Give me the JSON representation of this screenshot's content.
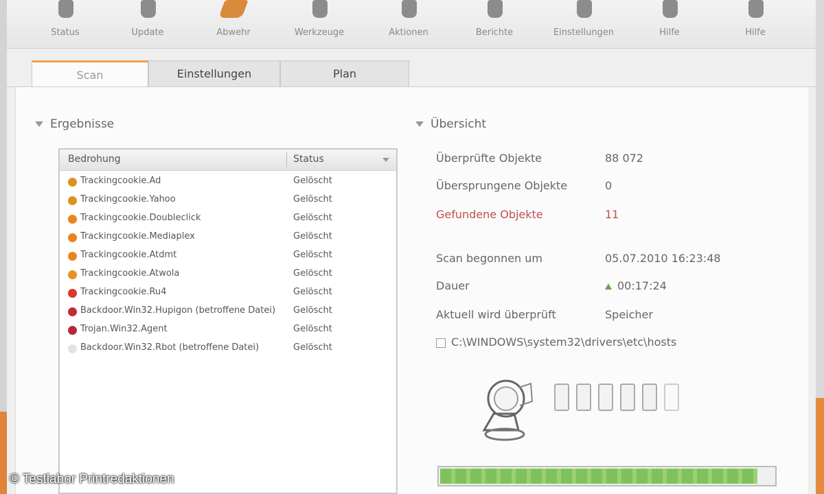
{
  "toolbar": {
    "items": [
      {
        "label": "Status",
        "icon": "status-icon"
      },
      {
        "label": "Update",
        "icon": "update-icon"
      },
      {
        "label": "Abwehr",
        "icon": "shield-icon"
      },
      {
        "label": "Werkzeuge",
        "icon": "tools-icon"
      },
      {
        "label": "Aktionen",
        "icon": "actions-icon"
      },
      {
        "label": "Berichte",
        "icon": "report-icon"
      },
      {
        "label": "Einstellungen",
        "icon": "settings-icon"
      },
      {
        "label": "Hilfe",
        "icon": "help-icon"
      },
      {
        "label": "Hilfe",
        "icon": "help-icon"
      }
    ],
    "active_index": 2
  },
  "tabs": [
    {
      "label": "Scan"
    },
    {
      "label": "Einstellungen"
    },
    {
      "label": "Plan"
    }
  ],
  "left": {
    "title": "Ergebnisse",
    "columns": [
      "Bedrohung",
      "Status"
    ],
    "rows": [
      {
        "name": "Trackingcookie.Ad",
        "status": "Gelöscht",
        "color": "#e0901f"
      },
      {
        "name": "Trackingcookie.Yahoo",
        "status": "Gelöscht",
        "color": "#e0901f"
      },
      {
        "name": "Trackingcookie.Doubleclick",
        "status": "Gelöscht",
        "color": "#e8851f"
      },
      {
        "name": "Trackingcookie.Mediaplex",
        "status": "Gelöscht",
        "color": "#e8851f"
      },
      {
        "name": "Trackingcookie.Atdmt",
        "status": "Gelöscht",
        "color": "#e8851f"
      },
      {
        "name": "Trackingcookie.Atwola",
        "status": "Gelöscht",
        "color": "#e8901f"
      },
      {
        "name": "Trackingcookie.Ru4",
        "status": "Gelöscht",
        "color": "#d9382a"
      },
      {
        "name": "Backdoor.Win32.Hupigon (betroffene Datei)",
        "status": "Gelöscht",
        "color": "#c42b39"
      },
      {
        "name": "Trojan.Win32.Agent",
        "status": "Gelöscht",
        "color": "#b8263a"
      },
      {
        "name": "Backdoor.Win32.Rbot (betroffene Datei)",
        "status": "Gelöscht",
        "color": "#e3e3e3"
      }
    ]
  },
  "overview": {
    "title": "Übersicht",
    "rows": [
      {
        "label": "Überprüfte Objekte",
        "value": "88 072",
        "color": "#666666"
      },
      {
        "label": "Übersprungene Objekte",
        "value": "0",
        "color": "#666666"
      },
      {
        "label": "Gefundene Objekte",
        "value": "11",
        "color": "#c0504d"
      },
      {
        "label": "Scan begonnen um",
        "value": "05.07.2010 16:23:48",
        "color": "#666666"
      },
      {
        "label": "Dauer",
        "value": "00:17:24",
        "color": "#666666"
      },
      {
        "label": "Aktuell wird überprüft",
        "value": "Speicher",
        "color": "#666666"
      }
    ],
    "path": "C:\\WINDOWS\\system32\\drivers\\etc\\hosts",
    "progress": 0.95
  },
  "credit": "© Testlabor Printredaktionen"
}
